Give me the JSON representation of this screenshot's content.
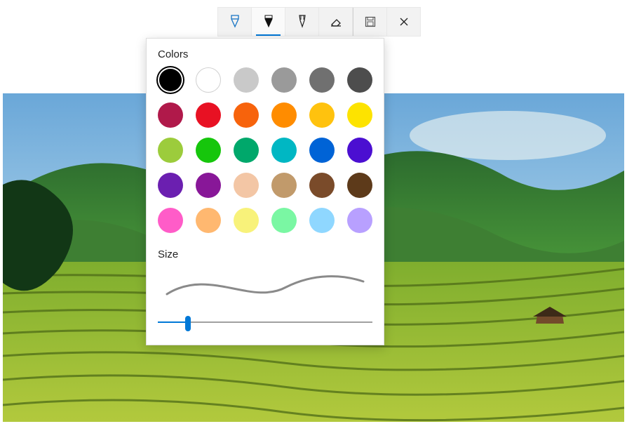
{
  "toolbar": {
    "tools": [
      {
        "id": "ballpoint-pen",
        "active": false
      },
      {
        "id": "pencil",
        "active": true
      },
      {
        "id": "highlighter",
        "active": false
      },
      {
        "id": "eraser",
        "active": false
      }
    ],
    "actions": [
      {
        "id": "save"
      },
      {
        "id": "close"
      }
    ]
  },
  "popup": {
    "colors_label": "Colors",
    "size_label": "Size",
    "selected_color_index": 0,
    "colors": [
      {
        "name": "black",
        "hex": "#000000"
      },
      {
        "name": "white",
        "hex": "#ffffff"
      },
      {
        "name": "silver",
        "hex": "#c9c9c9"
      },
      {
        "name": "gray",
        "hex": "#9a9a9a"
      },
      {
        "name": "dark-gray",
        "hex": "#707070"
      },
      {
        "name": "charcoal",
        "hex": "#4d4d4d"
      },
      {
        "name": "crimson",
        "hex": "#b0194a"
      },
      {
        "name": "red",
        "hex": "#e81123"
      },
      {
        "name": "orange",
        "hex": "#f7630c"
      },
      {
        "name": "amber",
        "hex": "#ff8c00"
      },
      {
        "name": "gold",
        "hex": "#ffc20e"
      },
      {
        "name": "yellow",
        "hex": "#fde300"
      },
      {
        "name": "lime",
        "hex": "#9ccc3c"
      },
      {
        "name": "green",
        "hex": "#16c60c"
      },
      {
        "name": "sea-green",
        "hex": "#00a86b"
      },
      {
        "name": "teal",
        "hex": "#00b7c3"
      },
      {
        "name": "blue",
        "hex": "#0063d6"
      },
      {
        "name": "indigo",
        "hex": "#4b0fd1"
      },
      {
        "name": "violet",
        "hex": "#6b1fb0"
      },
      {
        "name": "purple",
        "hex": "#881798"
      },
      {
        "name": "peach",
        "hex": "#f3c6a5"
      },
      {
        "name": "tan",
        "hex": "#c19a6b"
      },
      {
        "name": "brown",
        "hex": "#7a4b2a"
      },
      {
        "name": "dark-brown",
        "hex": "#5d3a1a"
      },
      {
        "name": "pink",
        "hex": "#ff5cc8"
      },
      {
        "name": "light-orange",
        "hex": "#ffb870"
      },
      {
        "name": "pale-yellow",
        "hex": "#f8f27a"
      },
      {
        "name": "mint",
        "hex": "#7af7a3"
      },
      {
        "name": "sky",
        "hex": "#8fd7ff"
      },
      {
        "name": "lavender",
        "hex": "#b8a0ff"
      }
    ],
    "size": {
      "value": 15,
      "min": 1,
      "max": 100
    }
  }
}
